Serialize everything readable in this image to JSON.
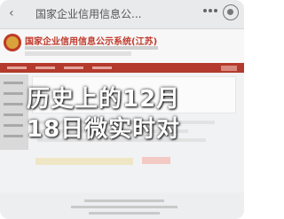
{
  "window": {
    "title": "国家企业信用信息公..."
  },
  "site": {
    "name": "国家企业信用信息公示系统(江苏)"
  },
  "overlay": {
    "line1": "历史上的12月",
    "line2": "18日微实时对"
  },
  "colors": {
    "brand_red": "#b83a2b",
    "overlay_text": "#ffffff"
  },
  "icons": {
    "back": "back-icon",
    "menu": "more-menu-icon",
    "close": "close-circle-icon",
    "emblem": "national-emblem-icon"
  }
}
